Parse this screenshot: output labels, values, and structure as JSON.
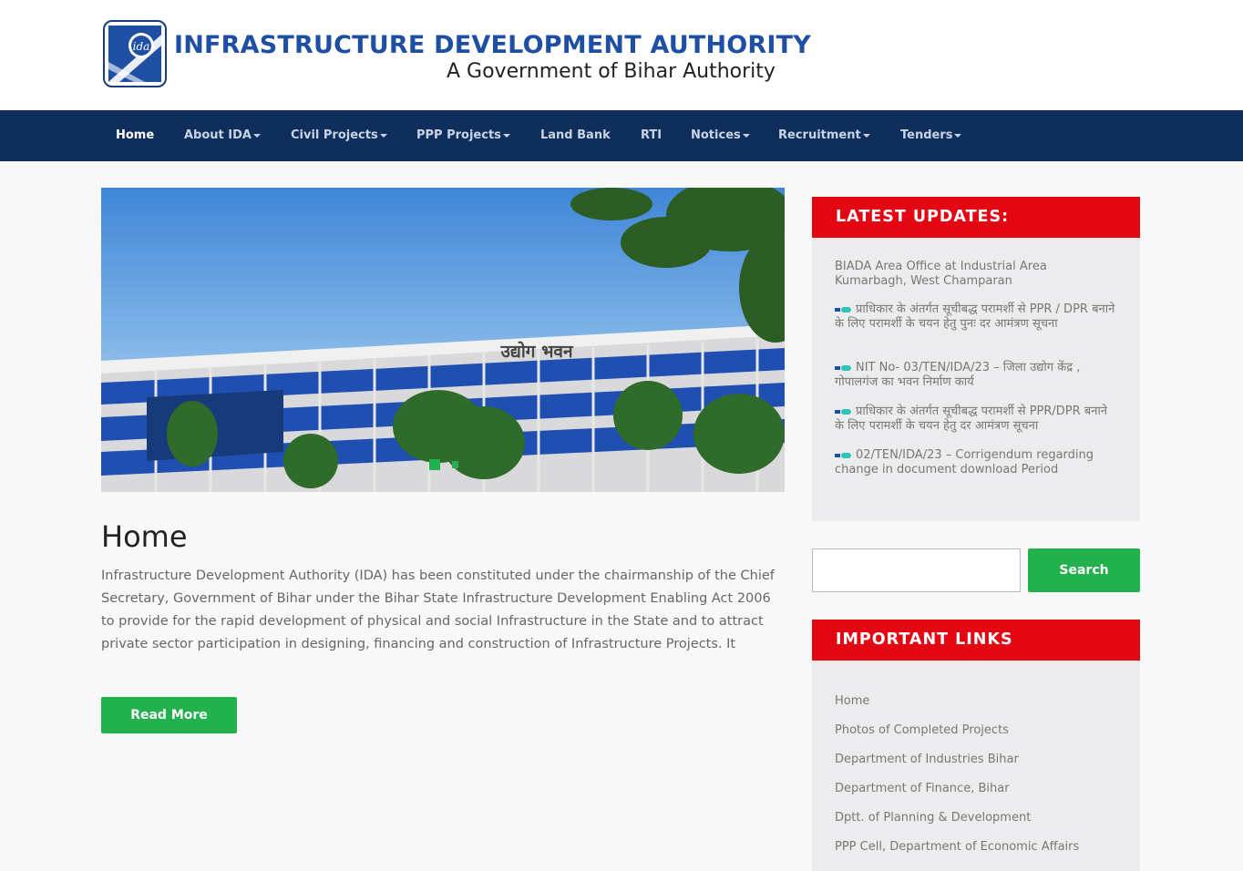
{
  "header": {
    "title": "INFRASTRUCTURE DEVELOPMENT AUTHORITY",
    "subtitle": "A Government of Bihar Authority",
    "logo_text": "ida"
  },
  "nav": {
    "items": [
      {
        "label": "Home",
        "dropdown": false
      },
      {
        "label": "About IDA",
        "dropdown": true
      },
      {
        "label": "Civil Projects",
        "dropdown": true
      },
      {
        "label": "PPP Projects",
        "dropdown": true
      },
      {
        "label": "Land Bank",
        "dropdown": false
      },
      {
        "label": "RTI",
        "dropdown": false
      },
      {
        "label": "Notices",
        "dropdown": true
      },
      {
        "label": "Recruitment",
        "dropdown": true
      },
      {
        "label": "Tenders",
        "dropdown": true
      }
    ]
  },
  "banner": {
    "building_sign": "उद्योग भवन",
    "icon": "building-photo"
  },
  "main": {
    "title": "Home",
    "intro": "Infrastructure Development Authority (IDA) has been constituted under the chairmanship of the Chief Secretary, Government of Bihar under the Bihar State Infrastructure Development Enabling Act 2006 to provide for the rapid development of physical and social Infrastructure in the State and to attract private sector participation in designing, financing and construction of Infrastructure Projects. It",
    "read_more_label": "Read More"
  },
  "updates": {
    "heading": "LATEST UPDATES:",
    "items": [
      {
        "text": "BIADA Area Office at Industrial Area Kumarbagh, West Champaran",
        "new": false
      },
      {
        "text": "प्राधिकार के अंतर्गत सूचीबद्ध परामर्शी से PPR / DPR बनाने के लिए परामर्शी के चयन हेतु पुनः दर आमंत्रण सूचना",
        "new": true
      },
      {
        "text": "NIT No- 03/TEN/IDA/23 – जिला उद्योग केंद्र , गोपालगंज का भवन निर्माण कार्य",
        "new": true
      },
      {
        "text": "प्राधिकार के अंतर्गत सूचीबद्ध परामर्शी से PPR/DPR बनाने के लिए परामर्शी के चयन हेतु दर आमंत्रण सूचना",
        "new": true
      },
      {
        "text": "02/TEN/IDA/23 – Corrigendum regarding change in document download Period",
        "new": true
      }
    ]
  },
  "search": {
    "placeholder": "",
    "button_label": "Search"
  },
  "links": {
    "heading": "IMPORTANT LINKS",
    "items": [
      "Home",
      "Photos of Completed Projects",
      "Department of Industries Bihar",
      "Department of Finance, Bihar",
      "Dptt. of Planning & Development",
      "PPP Cell, Department of Economic Affairs"
    ]
  },
  "colors": {
    "nav_bg": "#0f2e5b",
    "brand_blue": "#1f4fa3",
    "panel_red": "#e30613",
    "button_green": "#22b14c"
  }
}
